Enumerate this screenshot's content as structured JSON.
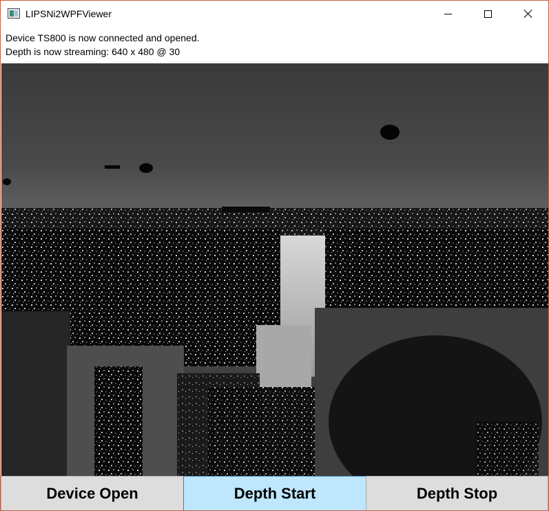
{
  "window": {
    "title": "LIPSNi2WPFViewer",
    "app_icon": "app-icon",
    "controls": {
      "minimize_icon": "minimize-icon",
      "maximize_icon": "maximize-icon",
      "close_icon": "close-icon"
    }
  },
  "status": {
    "line1": "Device TS800 is now connected and opened.",
    "line2": "Depth is now streaming: 640 x 480 @ 30"
  },
  "depth_view": {
    "content": "grayscale depth image stream"
  },
  "buttons": {
    "device_open": "Device Open",
    "depth_start": "Depth Start",
    "depth_stop": "Depth Stop"
  },
  "colors": {
    "window_border": "#c65a3f",
    "button_bg": "#dddddd",
    "button_active_bg": "#bee6fd",
    "button_active_border": "#3c7fb1"
  }
}
